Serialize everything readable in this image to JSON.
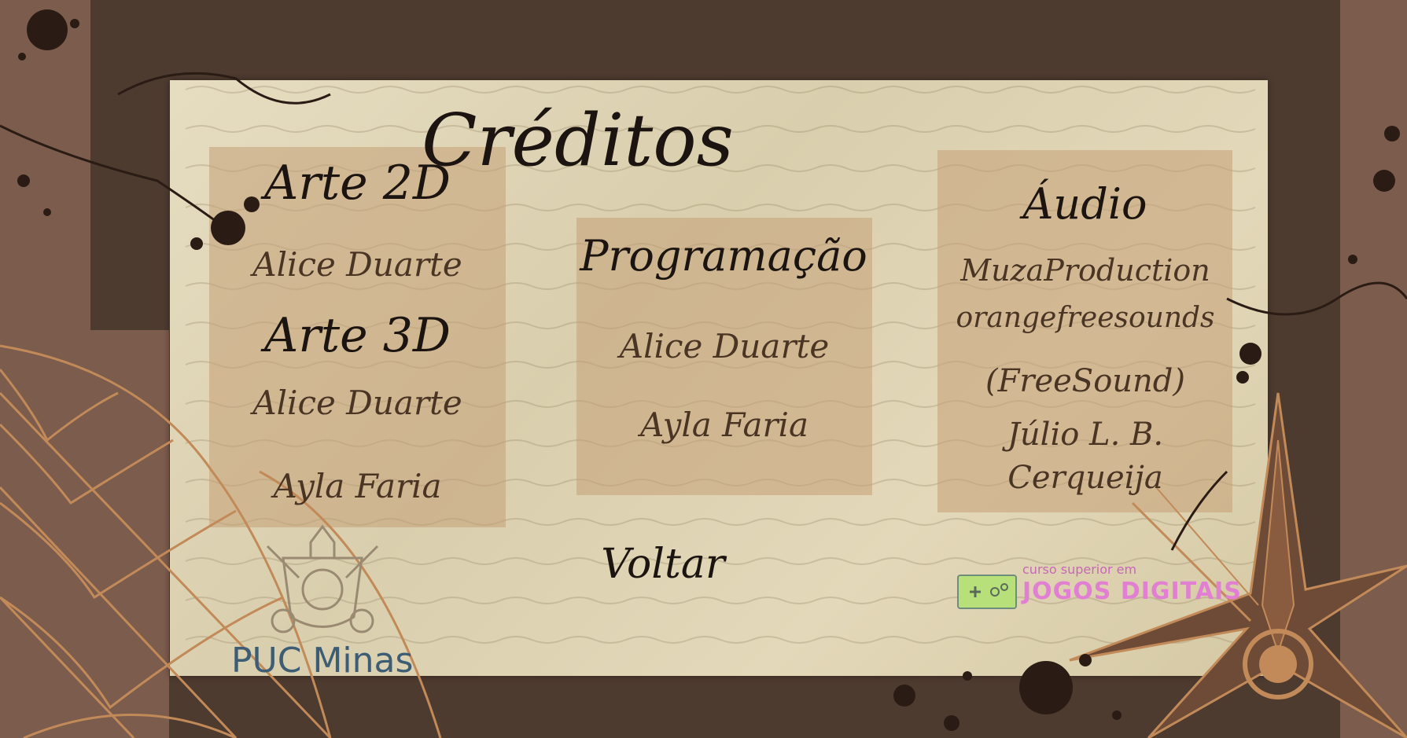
{
  "screen": {
    "title": "Créditos",
    "back_label": "Voltar"
  },
  "sections": {
    "arte2d": {
      "heading": "Arte 2D",
      "names": [
        "Alice Duarte"
      ]
    },
    "arte3d": {
      "heading": "Arte 3D",
      "names": [
        "Alice Duarte",
        "Ayla Faria"
      ]
    },
    "programacao": {
      "heading": "Programação",
      "names": [
        "Alice Duarte",
        "Ayla Faria"
      ]
    },
    "audio": {
      "heading": "Áudio",
      "names": [
        "MuzaProduction",
        "orangefreesounds",
        "(FreeSound)",
        "Júlio L. B.",
        "Cerqueija"
      ]
    }
  },
  "logos": {
    "puc": "PUC Minas",
    "course_sub": "curso superior em",
    "course_main": "JOGOS DIGITAIS"
  },
  "colors": {
    "frame": "#4e3b30",
    "frame_light": "#7c5c4d",
    "paper": "#e0d6b6",
    "ink": "#1c1410",
    "panel": "#c4a076",
    "puc_blue": "#3d5d74",
    "jogos_pink": "#e180d3"
  }
}
